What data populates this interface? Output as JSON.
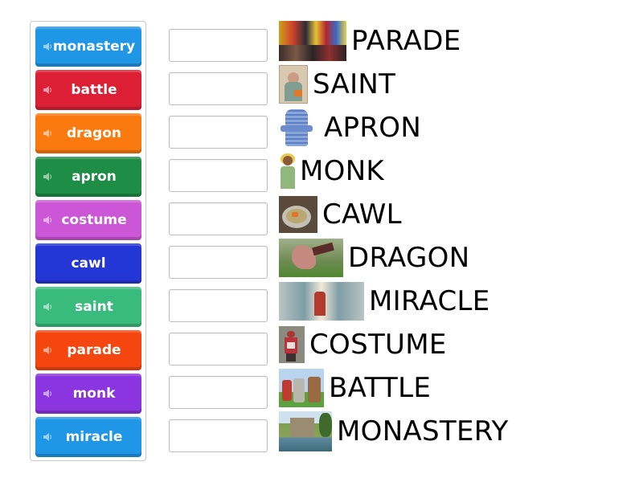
{
  "tiles": [
    {
      "label": "monastery",
      "color": "#1f97e6",
      "speaker": true
    },
    {
      "label": "battle",
      "color": "#dc1f35",
      "speaker": true
    },
    {
      "label": "dragon",
      "color": "#fb7a0f",
      "speaker": true
    },
    {
      "label": "apron",
      "color": "#1e8d45",
      "speaker": true
    },
    {
      "label": "costume",
      "color": "#cc57d6",
      "speaker": true
    },
    {
      "label": "cawl",
      "color": "#2436d6",
      "speaker": false
    },
    {
      "label": "saint",
      "color": "#3abb7e",
      "speaker": true
    },
    {
      "label": "parade",
      "color": "#f4460e",
      "speaker": true
    },
    {
      "label": "monk",
      "color": "#8a35e0",
      "speaker": true
    },
    {
      "label": "miracle",
      "color": "#1f97e6",
      "speaker": true
    }
  ],
  "targets": [
    {
      "word": "PARADE",
      "image": "parade-photo"
    },
    {
      "word": "SAINT",
      "image": "saint-portrait"
    },
    {
      "word": "APRON",
      "image": "apron-photo"
    },
    {
      "word": "MONK",
      "image": "monk-cartoon"
    },
    {
      "word": "CAWL",
      "image": "cawl-soup-photo"
    },
    {
      "word": "DRAGON",
      "image": "dragon-photo"
    },
    {
      "word": "MIRACLE",
      "image": "miracle-painting"
    },
    {
      "word": "COSTUME",
      "image": "costume-photo"
    },
    {
      "word": "BATTLE",
      "image": "battle-reenactment-photo"
    },
    {
      "word": "MONASTERY",
      "image": "monastery-photo"
    }
  ]
}
